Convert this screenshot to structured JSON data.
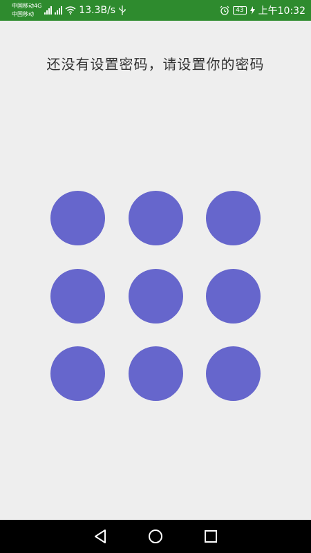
{
  "status_bar": {
    "carrier_1": "中国移动4G",
    "carrier_2": "中国移动",
    "network_type": "4G",
    "speed": "13.3B/s",
    "battery": "43",
    "time": "上午10:32"
  },
  "prompt": {
    "title": "还没有设置密码，请设置你的密码"
  },
  "pattern": {
    "dot_color": "#6666cc",
    "dots": [
      {
        "id": "1"
      },
      {
        "id": "2"
      },
      {
        "id": "3"
      },
      {
        "id": "4"
      },
      {
        "id": "5"
      },
      {
        "id": "6"
      },
      {
        "id": "7"
      },
      {
        "id": "8"
      },
      {
        "id": "9"
      }
    ]
  },
  "nav_bar": {
    "back_icon": "triangle-back",
    "home_icon": "circle-home",
    "recents_icon": "square-recents"
  },
  "colors": {
    "status_bar_bg": "#2e8b2e",
    "background": "#eeeeee",
    "nav_bar_bg": "#000000"
  }
}
